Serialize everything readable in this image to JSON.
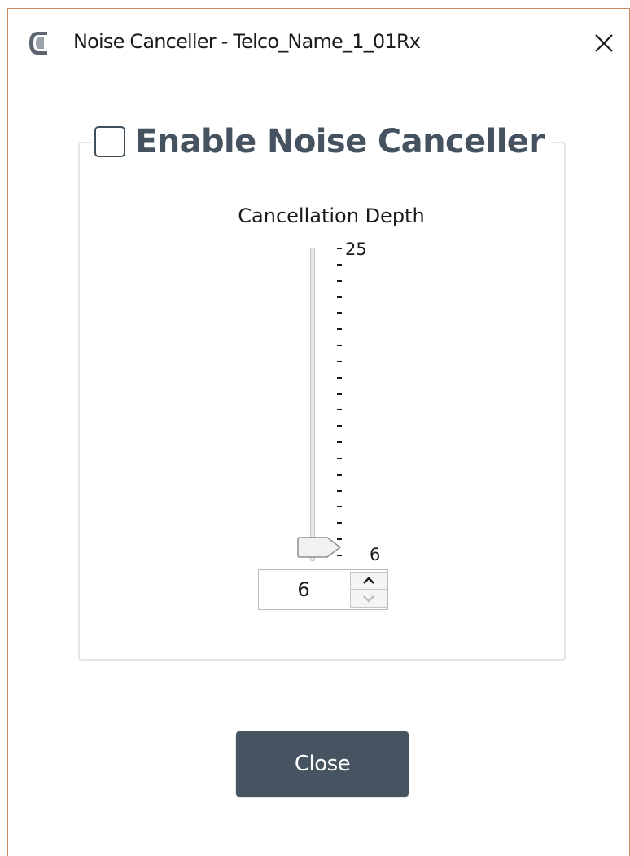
{
  "window": {
    "title": "Noise Canceller - Telco_Name_1_01Rx",
    "close_icon": "close-x-icon",
    "app_icon": "app-logo-icon",
    "border_color": "#c98a64"
  },
  "group": {
    "checkbox_label": "Enable Noise Canceller",
    "checkbox_checked": false
  },
  "slider": {
    "label": "Cancellation Depth",
    "max_label": "25",
    "min_label": "6",
    "min": 6,
    "max": 25,
    "value": 6
  },
  "spinbox": {
    "value": "6",
    "up_icon": "arrow-up-icon",
    "down_icon": "arrow-down-icon"
  },
  "footer": {
    "close_label": "Close",
    "accent_color": "#455460"
  }
}
